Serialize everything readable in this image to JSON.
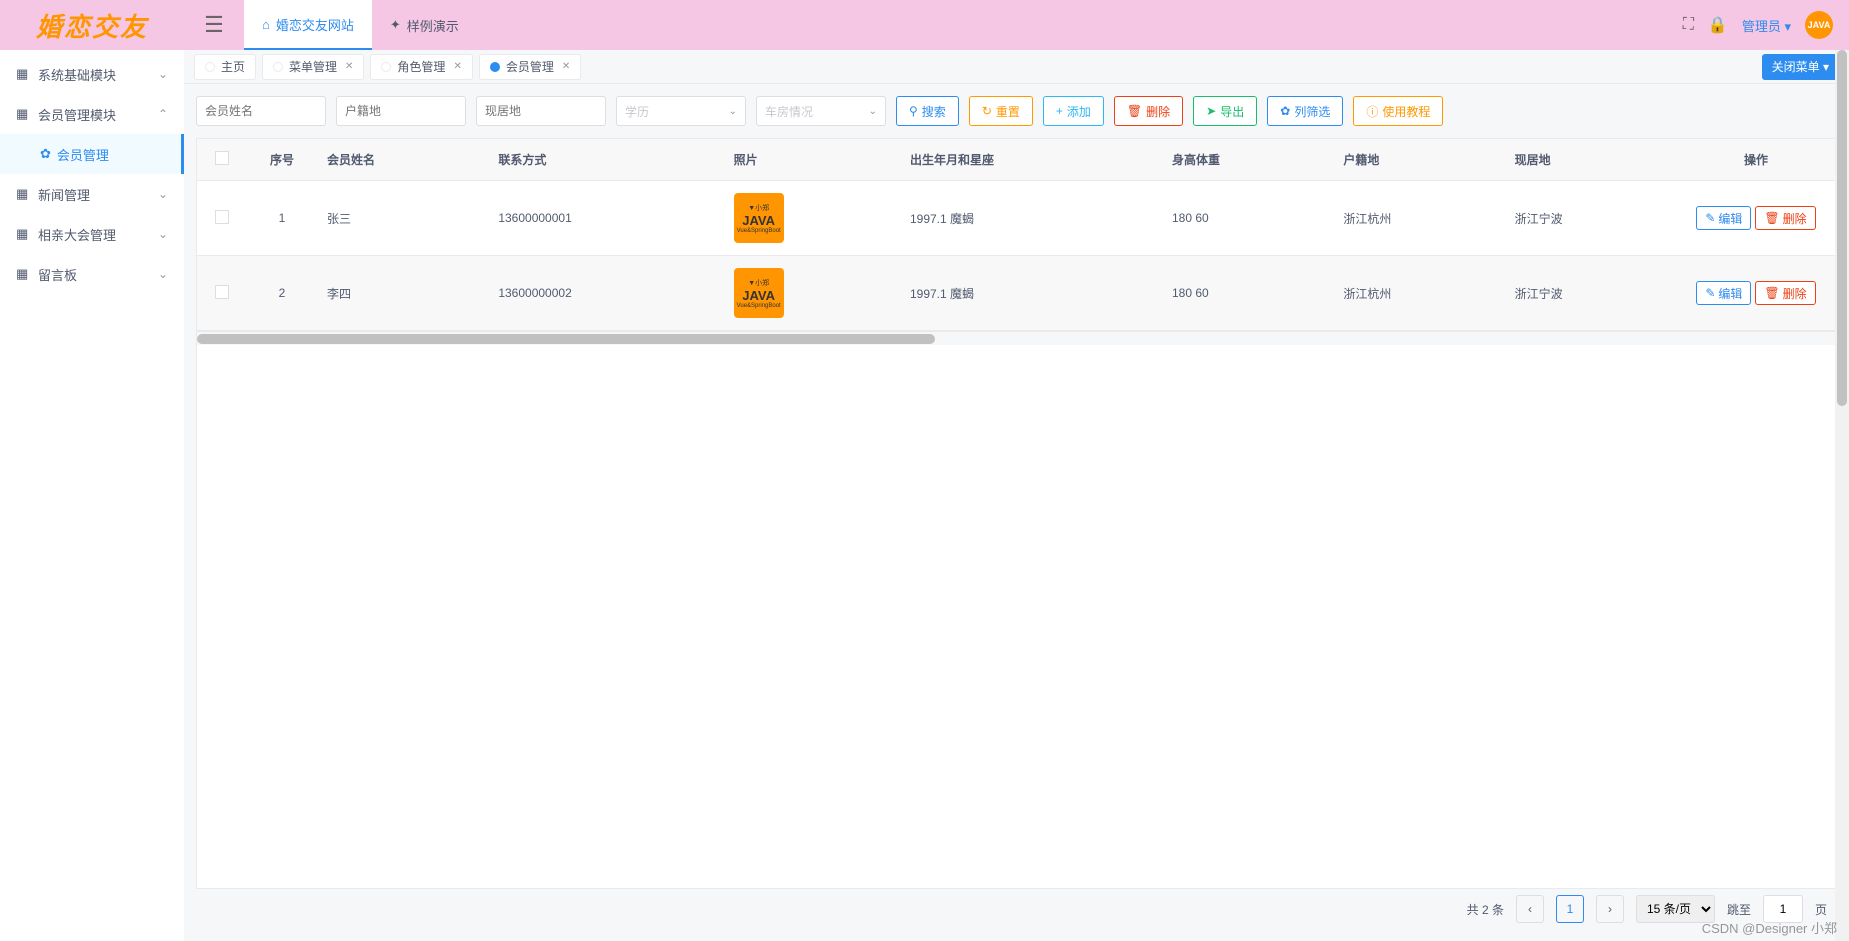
{
  "logo": "婚恋交友",
  "sidebar": {
    "items": [
      {
        "label": "系统基础模块",
        "expanded": false
      },
      {
        "label": "会员管理模块",
        "expanded": true,
        "children": [
          {
            "label": "会员管理",
            "active": true
          }
        ]
      },
      {
        "label": "新闻管理",
        "expanded": false
      },
      {
        "label": "相亲大会管理",
        "expanded": false
      },
      {
        "label": "留言板",
        "expanded": false
      }
    ]
  },
  "header": {
    "nav": [
      {
        "label": "婚恋交友网站",
        "icon": "home",
        "active": true
      },
      {
        "label": "样例演示",
        "icon": "sparkle",
        "active": false
      }
    ],
    "user": "管理员",
    "avatar_text": "JAVA"
  },
  "tabs": [
    {
      "label": "主页",
      "closable": false,
      "active": false
    },
    {
      "label": "菜单管理",
      "closable": true,
      "active": false
    },
    {
      "label": "角色管理",
      "closable": true,
      "active": false
    },
    {
      "label": "会员管理",
      "closable": true,
      "active": true
    }
  ],
  "close_menu_btn": "关闭菜单",
  "filters": {
    "name_ph": "会员姓名",
    "origin_ph": "户籍地",
    "residence_ph": "现居地",
    "edu_ph": "学历",
    "car_ph": "车房情况"
  },
  "buttons": {
    "search": "搜索",
    "reset": "重置",
    "add": "添加",
    "delete": "删除",
    "export": "导出",
    "filter": "列筛选",
    "guide": "使用教程",
    "edit": "编辑"
  },
  "table": {
    "headers": [
      "序号",
      "会员姓名",
      "联系方式",
      "照片",
      "出生年月和星座",
      "身高体重",
      "户籍地",
      "现居地",
      "操作"
    ],
    "rows": [
      {
        "no": "1",
        "name": "张三",
        "phone": "13600000001",
        "photo": "JAVA",
        "birth": "1997.1 魔蝎",
        "body": "180 60",
        "origin": "浙江杭州",
        "residence": "浙江宁波"
      },
      {
        "no": "2",
        "name": "李四",
        "phone": "13600000002",
        "photo": "JAVA",
        "birth": "1997.1 魔蝎",
        "body": "180 60",
        "origin": "浙江杭州",
        "residence": "浙江宁波"
      }
    ]
  },
  "pager": {
    "total": "共 2 条",
    "page": "1",
    "size_label": "15 条/页",
    "jump_label": "跳至",
    "jump_value": "1",
    "jump_suffix": "页"
  },
  "watermark": "CSDN @Designer 小郑"
}
